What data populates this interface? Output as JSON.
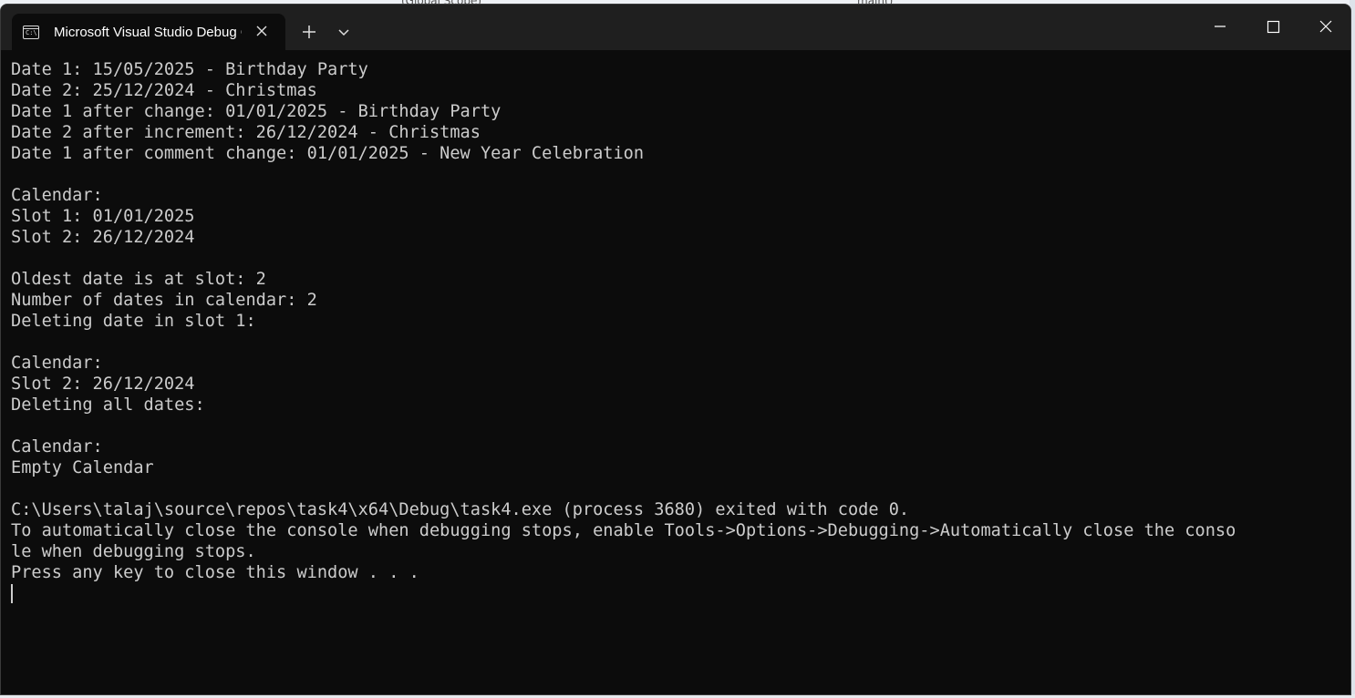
{
  "window": {
    "tab_title": "Microsoft Visual Studio Debug Console",
    "tab_icon_glyph": "C:\\",
    "new_tab_label": "+",
    "close_tab_label": "✕"
  },
  "background": {
    "scope_text": "(Global Scope)",
    "function_text": "main()"
  },
  "console": {
    "lines": [
      "Date 1: 15/05/2025 - Birthday Party",
      "Date 2: 25/12/2024 - Christmas",
      "Date 1 after change: 01/01/2025 - Birthday Party",
      "Date 2 after increment: 26/12/2024 - Christmas",
      "Date 1 after comment change: 01/01/2025 - New Year Celebration",
      "",
      "Calendar:",
      "Slot 1: 01/01/2025",
      "Slot 2: 26/12/2024",
      "",
      "Oldest date is at slot: 2",
      "Number of dates in calendar: 2",
      "Deleting date in slot 1:",
      "",
      "Calendar:",
      "Slot 2: 26/12/2024",
      "Deleting all dates:",
      "",
      "Calendar:",
      "Empty Calendar",
      "",
      "C:\\Users\\talaj\\source\\repos\\task4\\x64\\Debug\\task4.exe (process 3680) exited with code 0.",
      "To automatically close the console when debugging stops, enable Tools->Options->Debugging->Automatically close the conso",
      "le when debugging stops.",
      "Press any key to close this window . . ."
    ]
  },
  "colors": {
    "console_bg": "#0c0c0c",
    "console_text": "#cccccc",
    "titlebar_bg": "#1f1f1f"
  }
}
